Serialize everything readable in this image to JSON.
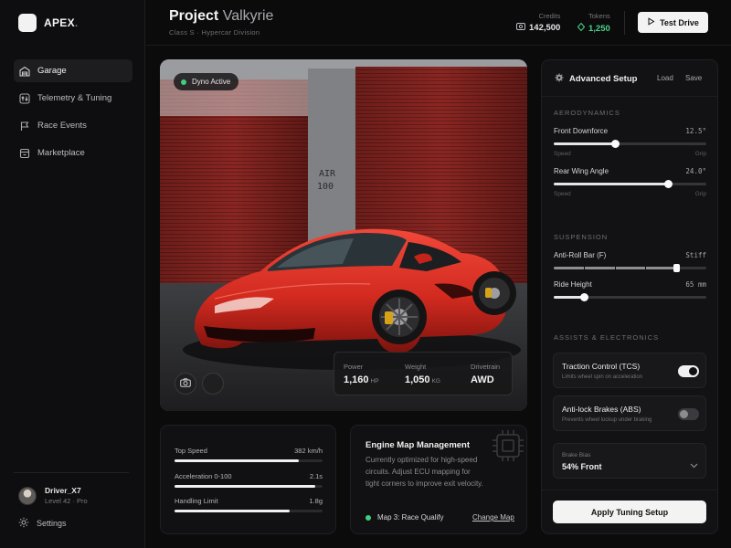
{
  "brand": {
    "name": "APEX",
    "dot": "."
  },
  "nav": {
    "items": [
      {
        "label": "Garage",
        "icon": "garage-icon"
      },
      {
        "label": "Telemetry & Tuning",
        "icon": "sliders-icon"
      },
      {
        "label": "Race Events",
        "icon": "flag-icon"
      },
      {
        "label": "Marketplace",
        "icon": "store-icon"
      }
    ]
  },
  "user": {
    "name": "Driver_X7",
    "level": "Level 42 · Pro"
  },
  "settings_label": "Settings",
  "header": {
    "title_main": "Project",
    "title_accent": "Valkyrie",
    "subtitle": "Class S · Hypercar Division",
    "credits_label": "Credits",
    "credits_value": "142,500",
    "tokens_label": "Tokens",
    "tokens_value": "1,250",
    "test_drive_label": "Test Drive"
  },
  "hero": {
    "status_badge": "Dyno Active",
    "wall_text_1": "AIR",
    "wall_text_2": "100",
    "specs": {
      "power_label": "Power",
      "power_value": "1,160",
      "power_unit": "HP",
      "weight_label": "Weight",
      "weight_value": "1,050",
      "weight_unit": "KG",
      "drivetrain_label": "Drivetrain",
      "drivetrain_value": "AWD"
    }
  },
  "metrics": [
    {
      "label": "Top Speed",
      "value": "382 km/h",
      "fill": 0.84
    },
    {
      "label": "Acceleration 0-100",
      "value": "2.1s",
      "fill": 0.95
    },
    {
      "label": "Handling Limit",
      "value": "1.8g",
      "fill": 0.78
    }
  ],
  "engine": {
    "title": "Engine Map Management",
    "description": "Currently optimized for high-speed circuits. Adjust ECU mapping for tight corners to improve exit velocity.",
    "active_map": "Map 3: Race Qualify",
    "change_label": "Change Map"
  },
  "setup": {
    "title": "Advanced Setup",
    "load_label": "Load",
    "save_label": "Save",
    "aero_label": "AERODYNAMICS",
    "front_downforce": {
      "label": "Front Downforce",
      "value": "12.5°",
      "min": "Speed",
      "max": "Grip",
      "level": 0.4
    },
    "rear_wing": {
      "label": "Rear Wing Angle",
      "value": "24.0°",
      "min": "Speed",
      "max": "Grip",
      "level": 0.75
    },
    "suspension_label": "SUSPENSION",
    "anti_roll": {
      "label": "Anti-Roll Bar (F)",
      "value": "Stiff",
      "level": 0.8
    },
    "ride_height": {
      "label": "Ride Height",
      "value": "65 mm",
      "level": 0.2
    },
    "assists_label": "ASSISTS & ELECTRONICS",
    "tcs": {
      "label": "Traction Control (TCS)",
      "sub": "Limits wheel spin on acceleration",
      "on": true
    },
    "abs": {
      "label": "Anti-lock Brakes (ABS)",
      "sub": "Prevents wheel lockup under braking",
      "on": false
    },
    "brake_bias_label": "Brake Bias",
    "brake_bias_value": "54% Front",
    "apply_label": "Apply Tuning Setup"
  },
  "colors": {
    "accent_green": "#3fd07e",
    "car_red": "#d8281e"
  }
}
